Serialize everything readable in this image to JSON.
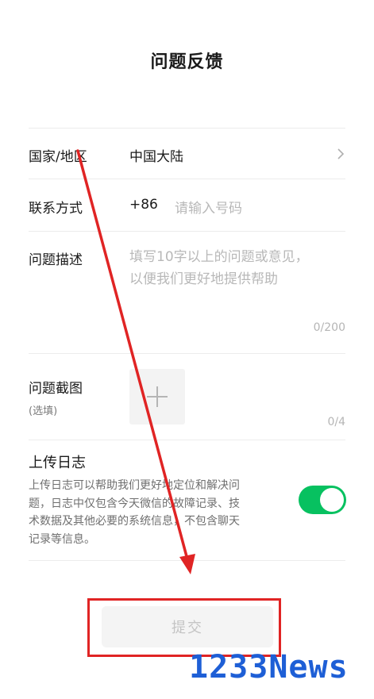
{
  "page": {
    "title": "问题反馈"
  },
  "region": {
    "label": "国家/地区",
    "value": "中国大陆"
  },
  "contact": {
    "label": "联系方式",
    "country_code": "+86",
    "placeholder": "请输入号码"
  },
  "description": {
    "label": "问题描述",
    "placeholder_line1": "填写10字以上的问题或意见，",
    "placeholder_line2": "以便我们更好地提供帮助",
    "counter": "0/200"
  },
  "screenshot": {
    "label": "问题截图",
    "optional": "(选填)",
    "counter": "0/4"
  },
  "upload_log": {
    "title": "上传日志",
    "line1": "上传日志可以帮助我们更好地定位和解决问",
    "line2": "题，日志中仅包含今天微信的故障记录、技",
    "line3": "术数据及其他必要的系统信息，不包含聊天",
    "line4": "记录等信息。",
    "enabled": true
  },
  "submit": {
    "label": "提交"
  },
  "watermark": {
    "text": "1233News"
  },
  "colors": {
    "toggle_on": "#07c160",
    "annotation_red": "#e02424",
    "watermark_blue": "#1e5fd6"
  },
  "icons": {
    "region_arrow": "chevron-right-icon",
    "upload": "plus-icon"
  }
}
